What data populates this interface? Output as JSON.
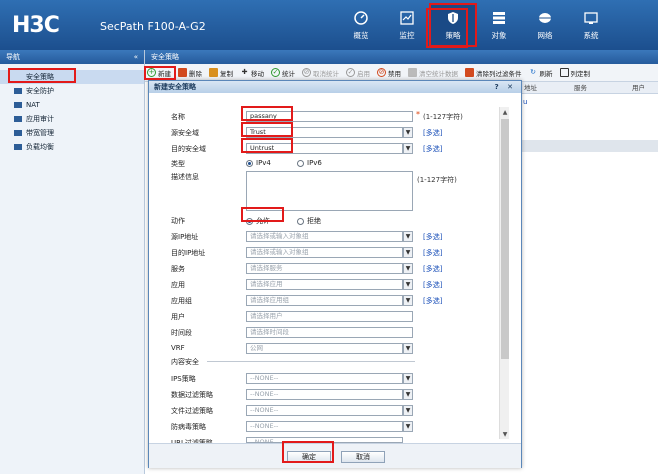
{
  "header": {
    "logo": "H3C",
    "product": "SecPath F100-A-G2",
    "nav": [
      {
        "label": "概览",
        "icon": "dashboard-icon"
      },
      {
        "label": "监控",
        "icon": "monitor-icon"
      },
      {
        "label": "策略",
        "icon": "shield-icon"
      },
      {
        "label": "对象",
        "icon": "list-icon"
      },
      {
        "label": "网络",
        "icon": "globe-icon"
      },
      {
        "label": "系统",
        "icon": "system-icon"
      }
    ]
  },
  "sidebar": {
    "title": "导航",
    "collapse": "«",
    "selected": "安全策略",
    "items": [
      "安全防护",
      "NAT",
      "应用审计",
      "带宽管理",
      "负载均衡"
    ]
  },
  "main": {
    "title": "安全策略",
    "toolbar": [
      {
        "label": "新建",
        "icon": "add-icon",
        "color": "#2f9a2f"
      },
      {
        "label": "删除",
        "icon": "delete-icon",
        "color": "#d24a1f"
      },
      {
        "label": "复制",
        "icon": "copy-icon",
        "color": "#d9901f"
      },
      {
        "label": "移动",
        "icon": "move-icon",
        "color": "#333333"
      },
      {
        "label": "统计",
        "icon": "stats-icon",
        "color": "#2f9a2f"
      },
      {
        "label": "取消统计",
        "icon": "cancel-stats-icon",
        "color": "#999999"
      },
      {
        "label": "启用",
        "icon": "enable-icon",
        "color": "#999999"
      },
      {
        "label": "禁用",
        "icon": "disable-icon",
        "color": "#d24a1f"
      },
      {
        "label": "清空统计数据",
        "icon": "clear-stats-icon",
        "color": "#999999"
      },
      {
        "label": "清除列过滤条件",
        "icon": "clear-filter-icon",
        "color": "#d24a1f"
      },
      {
        "label": "刷新",
        "icon": "refresh-icon",
        "color": "#1a6cc9"
      },
      {
        "label": "列定制",
        "icon": "columns-icon",
        "color": "#333333"
      }
    ],
    "columns": [
      "地址",
      "服务",
      "用户"
    ],
    "cell": "u"
  },
  "modal": {
    "title": "新建安全策略",
    "controls": "? ✕",
    "name_label": "名称",
    "name_value": "passany",
    "name_hint": "(1-127字符)",
    "src_zone_label": "源安全域",
    "src_zone_value": "Trust",
    "dst_zone_label": "目的安全域",
    "dst_zone_value": "Untrust",
    "multi": "[多选]",
    "type_label": "类型",
    "type_opts": [
      "IPv4",
      "IPv6"
    ],
    "desc_label": "描述信息",
    "desc_hint": "(1-127字符)",
    "action_label": "动作",
    "action_opts": [
      "允许",
      "拒绝"
    ],
    "src_ip_label": "源IP地址",
    "src_ip_ph": "请选择或输入对象组",
    "dst_ip_label": "目的IP地址",
    "dst_ip_ph": "请选择或输入对象组",
    "service_label": "服务",
    "service_ph": "请选择服务",
    "app_label": "应用",
    "app_ph": "请选择应用",
    "appgroup_label": "应用组",
    "appgroup_ph": "请选择应用组",
    "user_label": "用户",
    "user_ph": "请选择用户",
    "time_label": "时间段",
    "time_ph": "请选择时间段",
    "vrf_label": "VRF",
    "vrf_value": "公网",
    "content_section": "内容安全",
    "ips_label": "IPS策略",
    "data_label": "数据过滤策略",
    "file_label": "文件过滤策略",
    "av_label": "防病毒策略",
    "url_label": "URL过滤策略",
    "none": "--NONE--",
    "ok": "确定",
    "cancel": "取消"
  },
  "colors": {
    "header": "#1c4f8e",
    "highlight": "#e21a1a",
    "link": "#1a4fb8"
  }
}
